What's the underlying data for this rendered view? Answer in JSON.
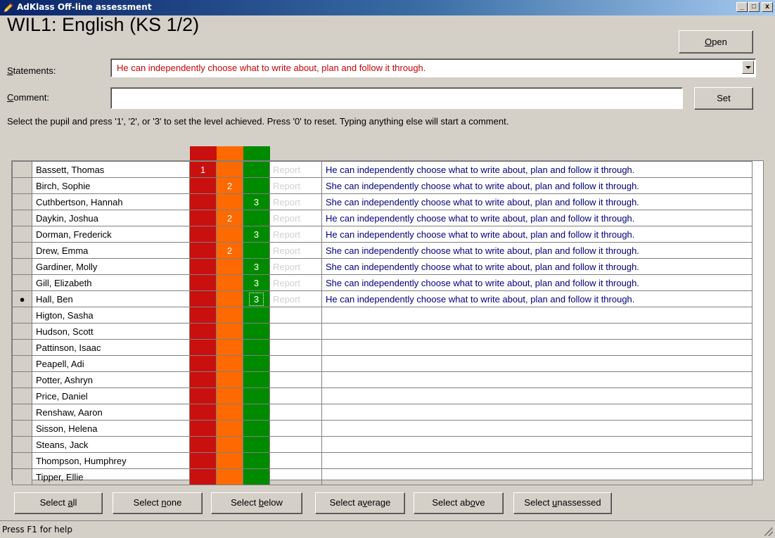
{
  "window": {
    "title": "AdKlass Off-line assessment",
    "minimize": "_",
    "maximize": "□",
    "close": "x"
  },
  "heading": "WIL1: English (KS 1/2)",
  "open_button": {
    "prefix": "",
    "ul": "O",
    "rest": "pen"
  },
  "statements": {
    "label_ul": "S",
    "label_rest": "tatements:",
    "value": "He can independently choose what to write about, plan and follow it through."
  },
  "comment": {
    "label_ul": "C",
    "label_rest": "omment:",
    "value": ""
  },
  "set_button": "Set",
  "instructions": "Select the pupil and press '1', '2', or '3' to set the level achieved.  Press '0' to reset.  Typing anything else will start a comment.",
  "level_colors": {
    "1": "#c8100e",
    "2": "#ff6a00",
    "3": "#008a00"
  },
  "report_label": "Report",
  "pupils": [
    {
      "name": "Bassett, Thomas",
      "level": "1",
      "comment": "He can independently choose what to write about, plan and follow it through.",
      "has_report": true,
      "selected": false
    },
    {
      "name": "Birch, Sophie",
      "level": "2",
      "comment": "She can independently choose what to write about, plan and follow it through.",
      "has_report": true,
      "selected": false
    },
    {
      "name": "Cuthbertson, Hannah",
      "level": "3",
      "comment": "She can independently choose what to write about, plan and follow it through.",
      "has_report": true,
      "selected": false
    },
    {
      "name": "Daykin, Joshua",
      "level": "2",
      "comment": "He can independently choose what to write about, plan and follow it through.",
      "has_report": true,
      "selected": false
    },
    {
      "name": "Dorman, Frederick",
      "level": "3",
      "comment": "He can independently choose what to write about, plan and follow it through.",
      "has_report": true,
      "selected": false
    },
    {
      "name": "Drew, Emma",
      "level": "2",
      "comment": "She can independently choose what to write about, plan and follow it through.",
      "has_report": true,
      "selected": false
    },
    {
      "name": "Gardiner, Molly",
      "level": "3",
      "comment": "She can independently choose what to write about, plan and follow it through.",
      "has_report": true,
      "selected": false
    },
    {
      "name": "Gill, Elizabeth",
      "level": "3",
      "comment": "She can independently choose what to write about, plan and follow it through.",
      "has_report": true,
      "selected": false
    },
    {
      "name": "Hall, Ben",
      "level": "3",
      "comment": "He can independently choose what to write about, plan and follow it through.",
      "has_report": true,
      "selected": true,
      "marker": "●"
    },
    {
      "name": "Higton, Sasha",
      "level": "",
      "comment": "",
      "has_report": false,
      "selected": false
    },
    {
      "name": "Hudson, Scott",
      "level": "",
      "comment": "",
      "has_report": false,
      "selected": false
    },
    {
      "name": "Pattinson, Isaac",
      "level": "",
      "comment": "",
      "has_report": false,
      "selected": false
    },
    {
      "name": "Peapell, Adi",
      "level": "",
      "comment": "",
      "has_report": false,
      "selected": false
    },
    {
      "name": "Potter, Ashryn",
      "level": "",
      "comment": "",
      "has_report": false,
      "selected": false
    },
    {
      "name": "Price, Daniel",
      "level": "",
      "comment": "",
      "has_report": false,
      "selected": false
    },
    {
      "name": "Renshaw, Aaron",
      "level": "",
      "comment": "",
      "has_report": false,
      "selected": false
    },
    {
      "name": "Sisson, Helena",
      "level": "",
      "comment": "",
      "has_report": false,
      "selected": false
    },
    {
      "name": "Steans, Jack",
      "level": "",
      "comment": "",
      "has_report": false,
      "selected": false
    },
    {
      "name": "Thompson, Humphrey",
      "level": "",
      "comment": "",
      "has_report": false,
      "selected": false
    },
    {
      "name": "Tipper, Ellie",
      "level": "",
      "comment": "",
      "has_report": false,
      "selected": false
    }
  ],
  "bottom_buttons": [
    {
      "name": "select-all-button",
      "pre": "Select ",
      "ul": "a",
      "post": "ll"
    },
    {
      "name": "select-none-button",
      "pre": "Select ",
      "ul": "n",
      "post": "one"
    },
    {
      "name": "select-below-button",
      "pre": "Select ",
      "ul": "b",
      "post": "elow"
    },
    {
      "name": "select-average-button",
      "pre": "Select a",
      "ul": "v",
      "post": "erage"
    },
    {
      "name": "select-above-button",
      "pre": "Select ab",
      "ul": "o",
      "post": "ve"
    },
    {
      "name": "select-unassessed-button",
      "pre": "Select ",
      "ul": "u",
      "post": "nassessed"
    }
  ],
  "status_text": "Press F1 for help"
}
